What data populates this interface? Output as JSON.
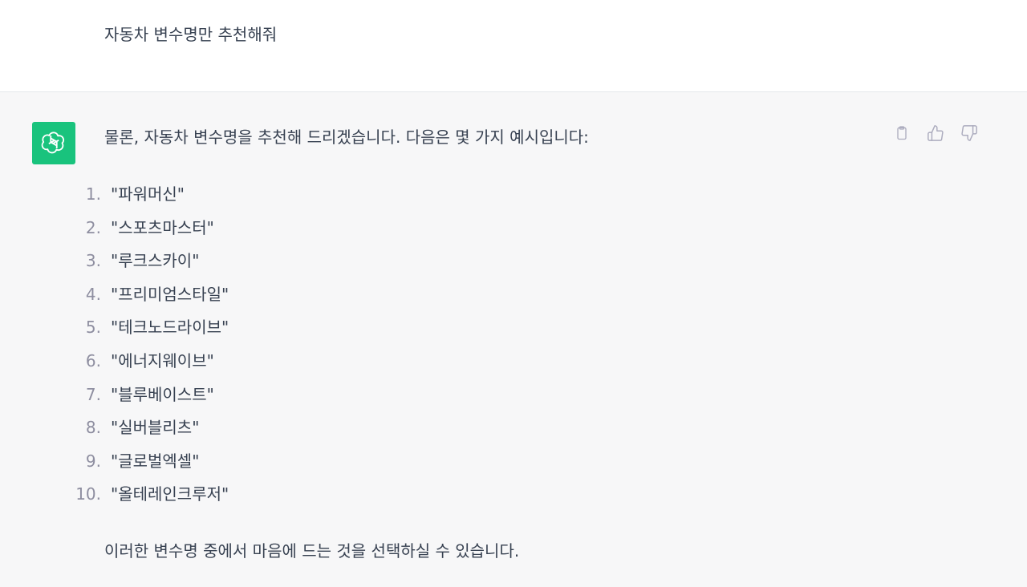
{
  "user_message": {
    "text": "자동차 변수명만 추천해줘"
  },
  "assistant_message": {
    "avatar_icon": "openai-logo-icon",
    "avatar_color": "#19c37d",
    "intro": "물론, 자동차 변수명을 추천해 드리겠습니다. 다음은 몇 가지 예시입니다:",
    "items": [
      {
        "num": "1.",
        "text": "\"파워머신\""
      },
      {
        "num": "2.",
        "text": "\"스포츠마스터\""
      },
      {
        "num": "3.",
        "text": "\"루크스카이\""
      },
      {
        "num": "4.",
        "text": "\"프리미엄스타일\""
      },
      {
        "num": "5.",
        "text": "\"테크노드라이브\""
      },
      {
        "num": "6.",
        "text": "\"에너지웨이브\""
      },
      {
        "num": "7.",
        "text": "\"블루베이스트\""
      },
      {
        "num": "8.",
        "text": "\"실버블리츠\""
      },
      {
        "num": "9.",
        "text": "\"글로벌엑셀\""
      },
      {
        "num": "10.",
        "text": "\"올테레인크루저\""
      }
    ],
    "outro": "이러한 변수명 중에서 마음에 드는 것을 선택하실 수 있습니다."
  },
  "actions": {
    "copy_icon": "clipboard-icon",
    "like_icon": "thumbs-up-icon",
    "dislike_icon": "thumbs-down-icon"
  }
}
